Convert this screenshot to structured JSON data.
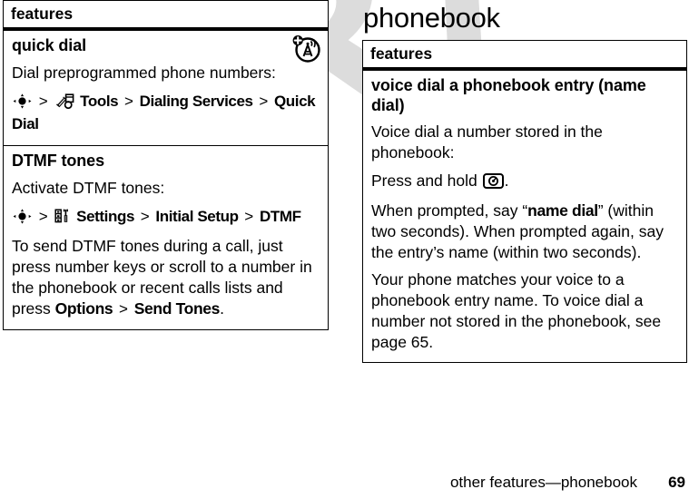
{
  "watermark": {
    "text": "DRAFT"
  },
  "left": {
    "table": {
      "header": "features",
      "rows": [
        {
          "title": "quick dial",
          "intro": "Dial preprogrammed phone numbers:",
          "nav": {
            "center_key": "center-select-key-icon",
            "sep1": ">",
            "tools_icon": "tools-icon",
            "item1": "Tools",
            "sep2": ">",
            "item2": "Dialing Services",
            "sep3": ">",
            "item3": "Quick Dial"
          },
          "corner_icon": "network-tower-plus-icon"
        },
        {
          "title": "DTMF tones",
          "intro": "Activate DTMF tones:",
          "nav": {
            "center_key": "center-select-key-icon",
            "sep1": ">",
            "settings_icon": "settings-tools-icon",
            "item1": "Settings",
            "sep2": ">",
            "item2": "Initial Setup",
            "sep3": ">",
            "item3": "DTMF"
          },
          "body_pre": "To send DTMF tones during a call, just press number keys or scroll to a number in the phonebook or recent calls lists and press ",
          "body_bold1": "Options",
          "body_sep": " > ",
          "body_bold2": "Send Tones",
          "body_post": "."
        }
      ]
    }
  },
  "right": {
    "title": "phonebook",
    "table": {
      "header": "features",
      "rows": [
        {
          "title": "voice dial a phonebook entry (name dial)",
          "para1": "Voice dial a number stored in the phonebook:",
          "para2_pre": "Press and hold ",
          "para2_icon": "voice-dial-key-icon",
          "para2_post": ".",
          "para3_pre": "When prompted, say “",
          "para3_bold": "name dial",
          "para3_post": "” (within two seconds). When prompted again, say the entry’s name (within two seconds).",
          "para4": "Your phone matches your voice to a phonebook entry name. To voice dial a number not stored in the phonebook, see page 65."
        }
      ]
    }
  },
  "footer": {
    "text": "other features—phonebook",
    "page": "69"
  },
  "colors": {
    "ink": "#000000",
    "paper": "#ffffff",
    "watermark": "#dcdcdc"
  }
}
